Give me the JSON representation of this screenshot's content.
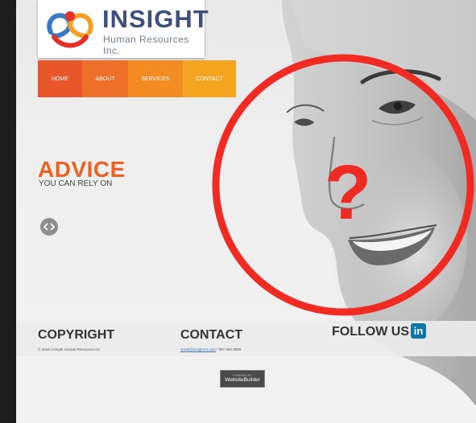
{
  "logo": {
    "title": "INSIGHT",
    "subtitle": "Human Resources Inc."
  },
  "nav": {
    "items": [
      {
        "label": "HOME",
        "color": "#e8562a"
      },
      {
        "label": "ABOUT",
        "color": "#ee6f28"
      },
      {
        "label": "SERVICES",
        "color": "#f28c22"
      },
      {
        "label": "CONTACT",
        "color": "#f4a51f"
      }
    ]
  },
  "hero": {
    "title": "ADVICE",
    "subtitle": "YOU CAN RELY ON"
  },
  "footer": {
    "copyright_heading": "COPYRIGHT",
    "copyright_text": "© 2018 | Insight Human Resources Inc.",
    "contact_heading": "CONTACT",
    "contact_email": "sarah@insight-hr.com",
    "contact_phone": " / 587.683.3059",
    "follow_heading": "FOLLOW US",
    "linkedin_label": "in"
  },
  "badge": {
    "top": "POWERED BY",
    "main": "WebsiteBuilder"
  },
  "overlay": {
    "mark": "?",
    "color": "#f02b24"
  }
}
